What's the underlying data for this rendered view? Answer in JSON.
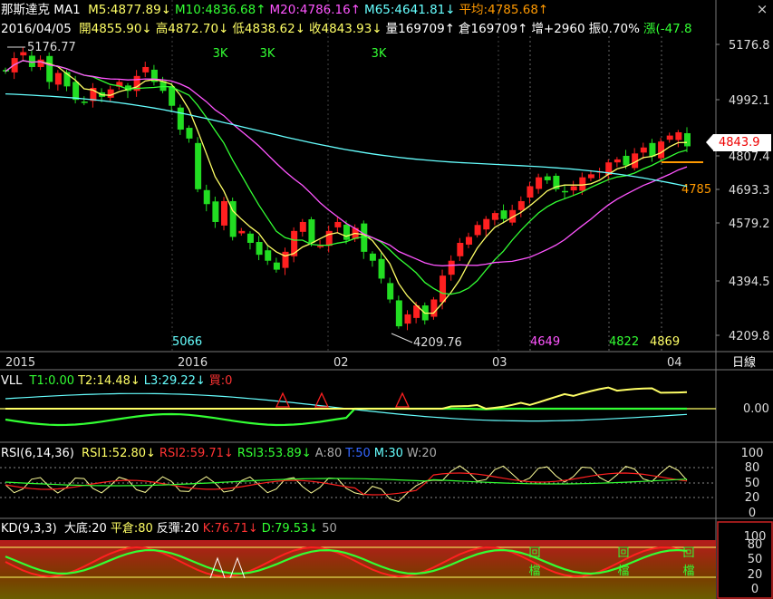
{
  "header": {
    "name": "那斯達克",
    "ma_label": "MA1",
    "ma": [
      {
        "text": "M5:4877.89",
        "arrow": "↓",
        "color": "#ffff66"
      },
      {
        "text": "M10:4836.68",
        "arrow": "↑",
        "color": "#33ff33"
      },
      {
        "text": "M20:4786.16",
        "arrow": "↑",
        "color": "#ff55ff"
      },
      {
        "text": "M65:4641.81",
        "arrow": "↓",
        "color": "#66ffff"
      },
      {
        "text": "平均:4785.68",
        "arrow": "↑",
        "color": "#ff9900"
      }
    ],
    "date": "2016/04/05",
    "quote": [
      {
        "text": "開4855.90",
        "arrow": "↓",
        "color": "#ffff66"
      },
      {
        "text": "高4872.70",
        "arrow": "↓",
        "color": "#ffff66"
      },
      {
        "text": "低4838.62",
        "arrow": "↓",
        "color": "#ffff66"
      },
      {
        "text": "收4843.93",
        "arrow": "↓",
        "color": "#ffff66"
      },
      {
        "text": "量169709",
        "arrow": "↑",
        "color": "#ffffff"
      },
      {
        "text": "倉169709",
        "arrow": "↑",
        "color": "#ffffff"
      },
      {
        "text": "增+2960",
        "arrow": "",
        "color": "#ffffff"
      },
      {
        "text": "振0.70%",
        "arrow": "",
        "color": "#ffffff"
      },
      {
        "text": "漲(-47.8",
        "arrow": "",
        "color": "#33ff33"
      }
    ],
    "close_symbol": "×"
  },
  "price_axis": {
    "ticks": [
      "5176.8",
      "4992.1",
      "4807.4",
      "4693.3",
      "4579.2",
      "4394.5",
      "4209.8"
    ],
    "current": "4843.9",
    "avg_label": "4785"
  },
  "annotations": {
    "high": "5176.77",
    "low": "4209.76",
    "three_k": [
      "3K",
      "3K",
      "3K"
    ],
    "markers": [
      {
        "text": "5066",
        "color": "#66ffff"
      },
      {
        "text": "4649",
        "color": "#ff55ff"
      },
      {
        "text": "4822",
        "color": "#33ff33"
      },
      {
        "text": "4869",
        "color": "#ffff66"
      }
    ]
  },
  "time_axis": {
    "labels": [
      "2015",
      "2016",
      "02",
      "03",
      "04"
    ],
    "period": "日線"
  },
  "vll": {
    "name": "VLL",
    "items": [
      {
        "text": "T1:0.00",
        "arrow": "",
        "color": "#33ff33"
      },
      {
        "text": "T2:14.48",
        "arrow": "↓",
        "color": "#ffff66"
      },
      {
        "text": "L3:29.22",
        "arrow": "↓",
        "color": "#66ffff"
      },
      {
        "text": "買:0",
        "arrow": "",
        "color": "#ff3333"
      }
    ],
    "axis": [
      "0.00"
    ]
  },
  "rsi": {
    "name": "RSI(6,14,36)",
    "items": [
      {
        "text": "RSI1:52.80",
        "arrow": "↓",
        "color": "#ffff66"
      },
      {
        "text": "RSI2:59.71",
        "arrow": "↓",
        "color": "#ff3333"
      },
      {
        "text": "RSI3:53.89",
        "arrow": "↓",
        "color": "#33ff33"
      },
      {
        "text": "A:80",
        "arrow": "",
        "color": "#aaaaaa"
      },
      {
        "text": "T:50",
        "arrow": "",
        "color": "#3366ff"
      },
      {
        "text": "M:30",
        "arrow": "",
        "color": "#66ffff"
      },
      {
        "text": "W:20",
        "arrow": "",
        "color": "#aaaaaa"
      }
    ],
    "axis": [
      "100",
      "80",
      "50",
      "20",
      "0"
    ]
  },
  "kd": {
    "name": "KD(9,3,3)",
    "items": [
      {
        "text": "大底:20",
        "arrow": "",
        "color": "#ffffff"
      },
      {
        "text": "平倉:80",
        "arrow": "",
        "color": "#ffff66"
      },
      {
        "text": "反彈:20",
        "arrow": "",
        "color": "#ffffff"
      },
      {
        "text": "K:76.71",
        "arrow": "↓",
        "color": "#ff3333"
      },
      {
        "text": "D:79.53",
        "arrow": "↓",
        "color": "#33ff33"
      },
      {
        "text": "50",
        "arrow": "",
        "color": "#aaaaaa"
      }
    ],
    "axis": [
      "100",
      "80",
      "50",
      "20",
      "0"
    ],
    "signals": [
      "回檔",
      "回檔",
      "回檔"
    ]
  },
  "colors": {
    "up": "#ff2020",
    "down": "#22dd22",
    "ma5": "#ffff66",
    "ma10": "#33ff33",
    "ma20": "#ff55ff",
    "ma65": "#66ffff",
    "avg": "#ff9900"
  },
  "chart_data": {
    "type": "candlestick",
    "title": "那斯達克",
    "period": "daily",
    "x_range": [
      "2015-12-29",
      "2016-04-05"
    ],
    "ylim": [
      4209.8,
      5176.8
    ],
    "last": {
      "date": "2016/04/05",
      "open": 4855.9,
      "high": 4872.7,
      "low": 4838.62,
      "close": 4843.93,
      "volume": 169709
    },
    "high": 5176.77,
    "low": 4209.76,
    "closes": [
      5095,
      5140,
      5160,
      5110,
      5135,
      5060,
      5090,
      5045,
      5000,
      4990,
      5040,
      5010,
      5035,
      5060,
      5030,
      5080,
      5110,
      5060,
      5030,
      4980,
      4900,
      4870,
      4700,
      4650,
      4590,
      4660,
      4540,
      4560,
      4520,
      4480,
      4460,
      4430,
      4490,
      4560,
      4590,
      4520,
      4510,
      4560,
      4590,
      4530,
      4570,
      4490,
      4460,
      4400,
      4330,
      4240,
      4280,
      4310,
      4260,
      4330,
      4410,
      4460,
      4520,
      4540,
      4580,
      4600,
      4620,
      4600,
      4630,
      4660,
      4710,
      4740,
      4730,
      4700,
      4690,
      4710,
      4740,
      4750,
      4760,
      4790,
      4800,
      4780,
      4820,
      4840,
      4810,
      4860,
      4880,
      4891,
      4843.93
    ],
    "ma": {
      "M5": 4877.89,
      "M10": 4836.68,
      "M20": 4786.16,
      "M65": 4641.81,
      "avg": 4785.68
    }
  }
}
